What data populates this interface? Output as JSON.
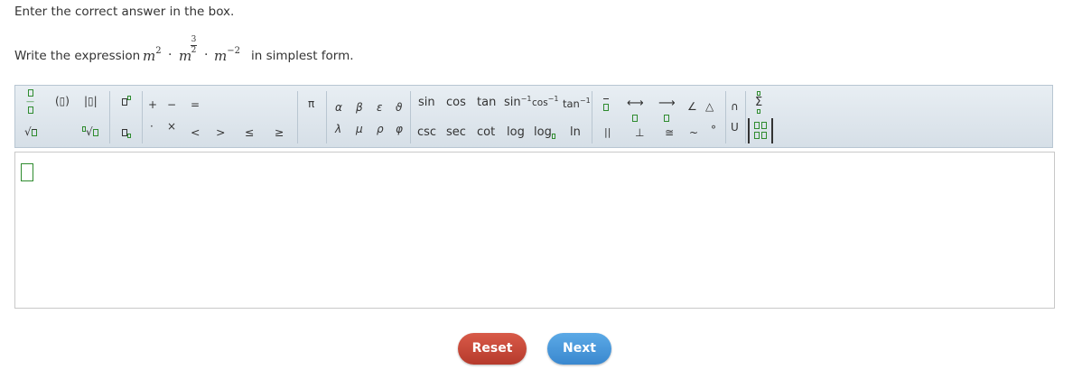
{
  "instruction": "Enter the correct answer in the box.",
  "question": {
    "prefix": "Write the expression",
    "term1_base": "m",
    "term1_exp": "2",
    "dot": "·",
    "term2_base": "m",
    "term2_exp_num": "3",
    "term2_exp_den": "2",
    "term3_base": "m",
    "term3_exp": "−2",
    "suffix": "in simplest form."
  },
  "toolbar": {
    "paren": "(▯)",
    "abs": "|▯|",
    "plus": "+",
    "minus": "−",
    "equals": "=",
    "times": "×",
    "middot": "·",
    "lt": "<",
    "gt": ">",
    "le": "≤",
    "ge": "≥",
    "pi": "π",
    "greek": [
      "α",
      "β",
      "ε",
      "ϑ",
      "λ",
      "μ",
      "ρ",
      "φ"
    ],
    "trig_row1": [
      "sin",
      "cos",
      "tan"
    ],
    "trig_inv": [
      "sin",
      "cos",
      "tan"
    ],
    "inv_exp": "−1",
    "trig_row2": [
      "csc",
      "sec",
      "cot",
      "log"
    ],
    "logb": "log",
    "ln": "ln",
    "parallel": "||",
    "perp": "⊥",
    "congruent": "≅",
    "similar": "~",
    "degree": "°",
    "angle": "∠",
    "triangle": "△",
    "line": "⟷",
    "ray": "⟶",
    "cap": "∩",
    "cup": "U",
    "sigma": "Σ"
  },
  "buttons": {
    "reset": "Reset",
    "next": "Next"
  },
  "colors": {
    "reset": "#c84a3a",
    "next": "#4a98da",
    "placeholder_green": "#2e8b2e"
  }
}
